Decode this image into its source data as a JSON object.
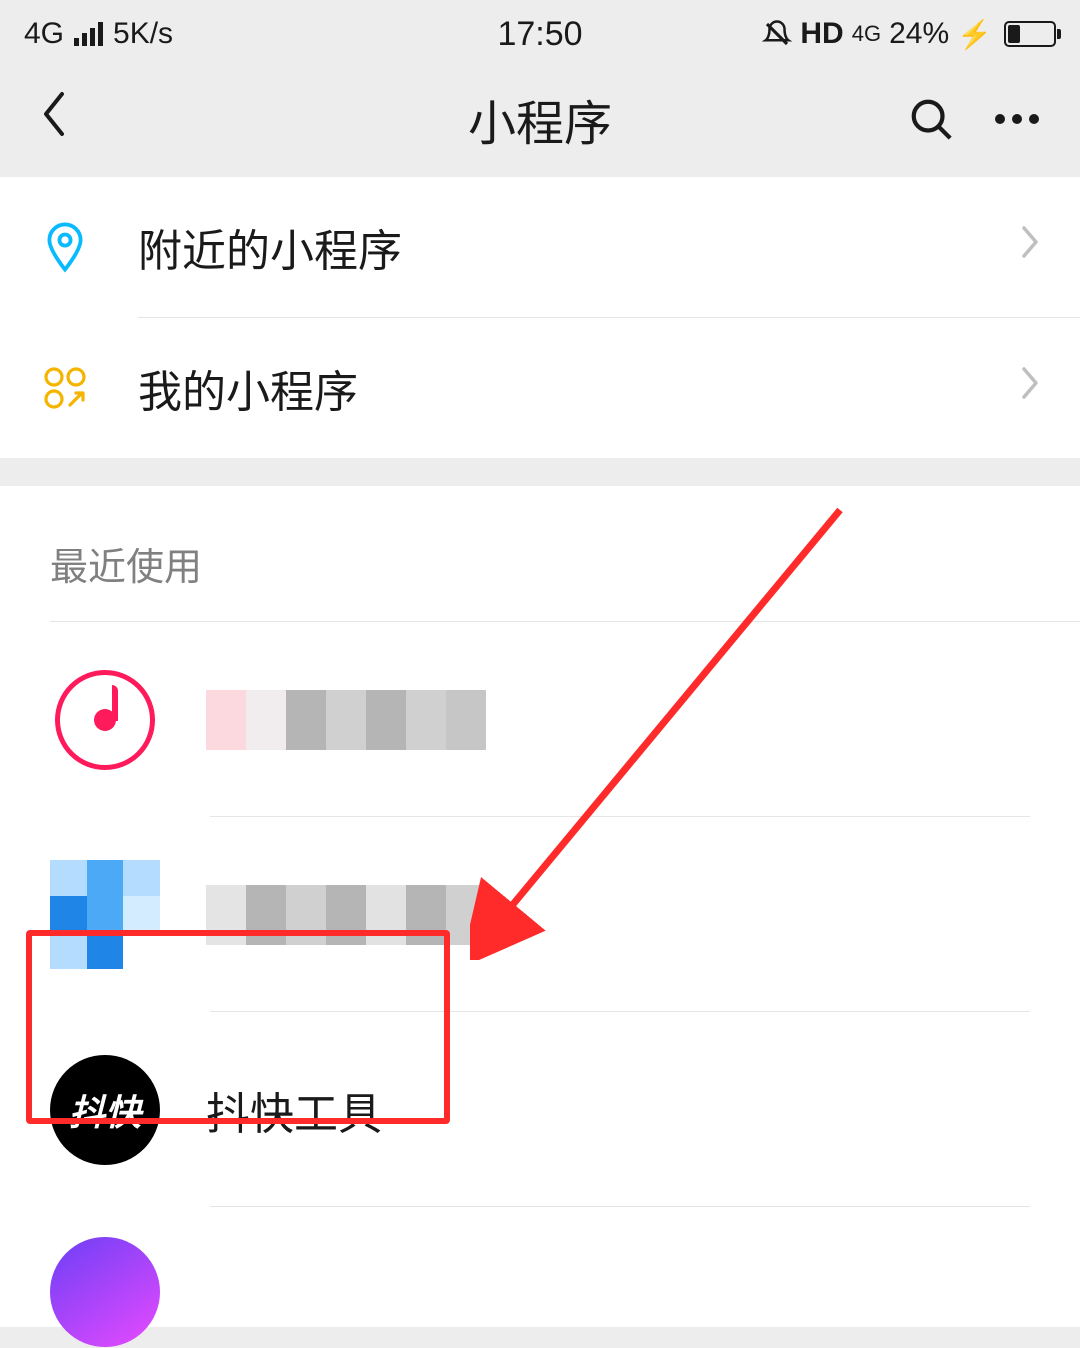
{
  "status": {
    "network": "4G",
    "speed": "5K/s",
    "time": "17:50",
    "hd": "HD",
    "net2": "4G",
    "battery_pct": "24%"
  },
  "nav": {
    "title": "小程序"
  },
  "menu": {
    "nearby": "附近的小程序",
    "mine": "我的小程序"
  },
  "recent": {
    "title": "最近使用",
    "item3": "抖快工具",
    "item3_icon": "抖快"
  }
}
